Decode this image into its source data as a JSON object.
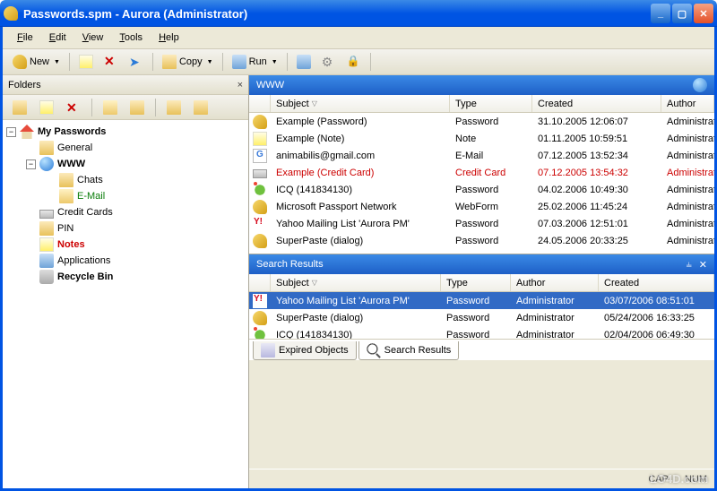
{
  "title": "Passwords.spm - Aurora (Administrator)",
  "menu": {
    "file": "File",
    "edit": "Edit",
    "view": "View",
    "tools": "Tools",
    "help": "Help"
  },
  "toolbar": {
    "new": "New",
    "copy": "Copy",
    "run": "Run"
  },
  "folders": {
    "title": "Folders",
    "tree": {
      "root": "My Passwords",
      "general": "General",
      "www": "WWW",
      "chats": "Chats",
      "email": "E-Mail",
      "credit": "Credit Cards",
      "pin": "PIN",
      "notes": "Notes",
      "apps": "Applications",
      "bin": "Recycle Bin"
    }
  },
  "www": {
    "title": "WWW",
    "cols": {
      "subject": "Subject",
      "type": "Type",
      "created": "Created",
      "author": "Author"
    },
    "rows": [
      {
        "icon": "i-key",
        "subject": "Example (Password)",
        "type": "Password",
        "created": "31.10.2005 12:06:07",
        "author": "Administrator"
      },
      {
        "icon": "i-note",
        "subject": "Example (Note)",
        "type": "Note",
        "created": "01.11.2005 10:59:51",
        "author": "Administrator"
      },
      {
        "icon": "i-gmail",
        "subject": "animabilis@gmail.com",
        "type": "E-Mail",
        "created": "07.12.2005 13:52:34",
        "author": "Administrator"
      },
      {
        "icon": "i-card",
        "subject": "Example (Credit Card)",
        "type": "Credit Card",
        "created": "07.12.2005 13:54:32",
        "author": "Administrator",
        "red": true
      },
      {
        "icon": "i-icq",
        "subject": "ICQ (141834130)",
        "type": "Password",
        "created": "04.02.2006 10:49:30",
        "author": "Administrator"
      },
      {
        "icon": "i-key",
        "subject": "Microsoft Passport Network",
        "type": "WebForm",
        "created": "25.02.2006 11:45:24",
        "author": "Administrator"
      },
      {
        "icon": "i-yahoo",
        "subject": "Yahoo Mailing List 'Aurora PM'",
        "type": "Password",
        "created": "07.03.2006 12:51:01",
        "author": "Administrator"
      },
      {
        "icon": "i-key",
        "subject": "SuperPaste (dialog)",
        "type": "Password",
        "created": "24.05.2006 20:33:25",
        "author": "Administrator"
      }
    ]
  },
  "search": {
    "title": "Search Results",
    "cols": {
      "subject": "Subject",
      "type": "Type",
      "author": "Author",
      "created": "Created"
    },
    "rows": [
      {
        "icon": "i-yahoo",
        "subject": "Yahoo Mailing List 'Aurora PM'",
        "type": "Password",
        "author": "Administrator",
        "created": "03/07/2006 08:51:01",
        "selected": true
      },
      {
        "icon": "i-key",
        "subject": "SuperPaste (dialog)",
        "type": "Password",
        "author": "Administrator",
        "created": "05/24/2006 16:33:25"
      },
      {
        "icon": "i-icq",
        "subject": "ICQ (141834130)",
        "type": "Password",
        "author": "Administrator",
        "created": "02/04/2006 06:49:30"
      }
    ]
  },
  "tabs": {
    "expired": "Expired Objects",
    "search": "Search Results"
  },
  "status": {
    "cap": "CAP",
    "num": "NUM"
  },
  "watermark": "LO4D.com"
}
